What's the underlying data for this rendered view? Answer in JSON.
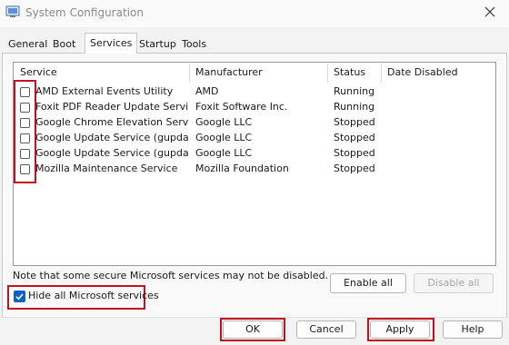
{
  "window": {
    "title": "System Configuration",
    "icon": "system-config-icon"
  },
  "tabs": [
    {
      "label": "General",
      "active": false
    },
    {
      "label": "Boot",
      "active": false
    },
    {
      "label": "Services",
      "active": true
    },
    {
      "label": "Startup",
      "active": false
    },
    {
      "label": "Tools",
      "active": false
    }
  ],
  "columns": [
    "Service",
    "Manufacturer",
    "Status",
    "Date Disabled"
  ],
  "services": [
    {
      "name": "AMD External Events Utility",
      "manufacturer": "AMD",
      "status": "Running",
      "checked": false
    },
    {
      "name": "Foxit PDF Reader Update Service",
      "manufacturer": "Foxit Software Inc.",
      "status": "Running",
      "checked": false
    },
    {
      "name": "Google Chrome Elevation Servic...",
      "manufacturer": "Google LLC",
      "status": "Stopped",
      "checked": false
    },
    {
      "name": "Google Update Service (gupdate)",
      "manufacturer": "Google LLC",
      "status": "Stopped",
      "checked": false
    },
    {
      "name": "Google Update Service (gupdatem)",
      "manufacturer": "Google LLC",
      "status": "Stopped",
      "checked": false
    },
    {
      "name": "Mozilla Maintenance Service",
      "manufacturer": "Mozilla Foundation",
      "status": "Stopped",
      "checked": false
    }
  ],
  "note": "Note that some secure Microsoft services may not be disabled.",
  "enable_all": "Enable all",
  "disable_all": "Disable all",
  "hide_ms": {
    "label": "Hide all Microsoft services",
    "checked": true
  },
  "buttons": {
    "ok": "OK",
    "cancel": "Cancel",
    "apply": "Apply",
    "help": "Help"
  },
  "colors": {
    "highlight": "#c0131f",
    "checkbox_accent": "#0a62c9"
  }
}
